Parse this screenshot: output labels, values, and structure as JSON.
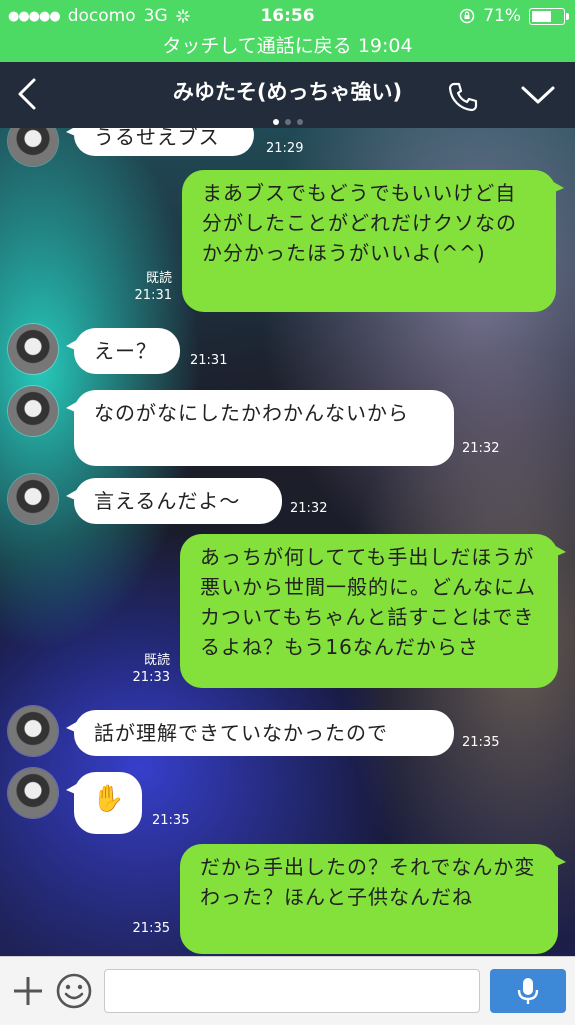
{
  "status_bar": {
    "carrier": "docomo",
    "network": "3G",
    "time": "16:56",
    "battery_percent": "71%",
    "battery_level": 0.71
  },
  "call_banner": {
    "text": "タッチして通話に戻る 19:04"
  },
  "header": {
    "title": "みゆたそ(めっちゃ強い)",
    "page_count": 3,
    "active_page": 0
  },
  "messages": [
    {
      "side": "in",
      "text": "うるせえブス",
      "time": "21:29"
    },
    {
      "side": "out",
      "text": "まあブスでもどうでもいいけど自分がしたことがどれだけクソなのか分かったほうがいいよ(^^)",
      "read": "既読",
      "time": "21:31"
    },
    {
      "side": "in",
      "text": "えー？",
      "time": "21:31"
    },
    {
      "side": "in",
      "text": "なのがなにしたかわかんないから",
      "time": "21:32"
    },
    {
      "side": "in",
      "text": "言えるんだよ〜",
      "time": "21:32"
    },
    {
      "side": "out",
      "text": "あっちが何してても手出しだほうが悪いから世間一般的に。どんなにムカついてもちゃんと話すことはできるよね？もう16なんだからさ",
      "read": "既読",
      "time": "21:33"
    },
    {
      "side": "in",
      "text": "話が理解できていなかったので",
      "time": "21:35"
    },
    {
      "side": "in",
      "text": "✋",
      "time": "21:35"
    },
    {
      "side": "out",
      "text": "だから手出したの？それでなんか変わった？ほんと子供なんだね",
      "read": "",
      "time": "21:35"
    }
  ],
  "input_bar": {
    "placeholder": "",
    "value": ""
  },
  "icons": {
    "back": "chevron-left-icon",
    "call": "phone-icon",
    "menu": "chevron-down-icon",
    "add": "plus-icon",
    "sticker": "smiley-icon",
    "voice": "microphone-icon"
  },
  "colors": {
    "status_bar": "#4cd964",
    "header": "#232c3b",
    "outgoing_bubble": "#84e03b",
    "incoming_bubble": "#ffffff",
    "mic_button": "#3e88d8"
  }
}
